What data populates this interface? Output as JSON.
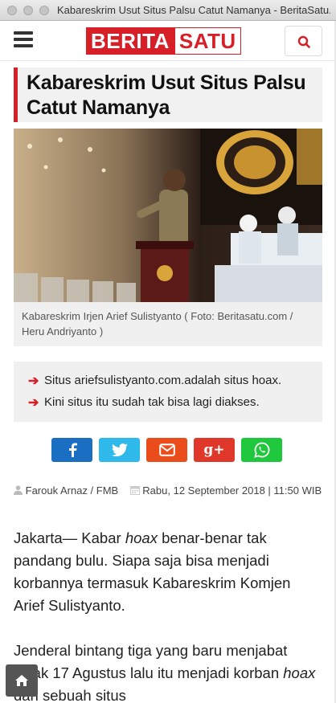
{
  "window": {
    "title": "Kabareskrim Usut Situs Palsu Catut Namanya - BeritaSatu.com"
  },
  "header": {
    "logo_part1": "BERITA",
    "logo_part2": "SATU",
    "menu_icon": "hamburger-icon",
    "search_icon": "search-icon"
  },
  "article": {
    "title": "Kabareskrim Usut Situs Palsu Catut Namanya",
    "photo_caption": "Kabareskrim Irjen Arief Sulistyanto ( Foto: Beritasatu.com / Heru Andriyanto )",
    "highlights": [
      "Situs ariefsulistyanto.com.adalah situs hoax.",
      "Kini situs itu sudah tak bisa lagi diakses."
    ],
    "author": "Farouk Arnaz / FMB",
    "date": "Rabu, 12 September 2018 | 11:50 WIB",
    "para1_a": "Jakarta— Kabar ",
    "para1_em": "hoax",
    "para1_b": " benar-benar tak pandang bulu. Siapa saja bisa menjadi korbannya termasuk Kabareskrim Komjen Arief Sulistyanto.",
    "para2_a": "Jenderal bintang tiga yang baru menjabat sejak 17 Agustus lalu itu menjadi korban ",
    "para2_em": "hoax",
    "para2_b": " dari sebuah situs"
  },
  "share": [
    {
      "network": "facebook",
      "icon": "facebook-icon",
      "color": "#1a6fc2"
    },
    {
      "network": "twitter",
      "icon": "twitter-icon",
      "color": "#2fb9ea"
    },
    {
      "network": "email",
      "icon": "envelope-icon",
      "color": "#ea4c1c"
    },
    {
      "network": "google-plus",
      "icon": "google-plus-icon",
      "color": "#e0372b"
    },
    {
      "network": "whatsapp",
      "icon": "whatsapp-icon",
      "color": "#1ec73c"
    }
  ],
  "colors": {
    "brand_red": "#d61f26",
    "panel_gray": "#f0f0f0"
  }
}
